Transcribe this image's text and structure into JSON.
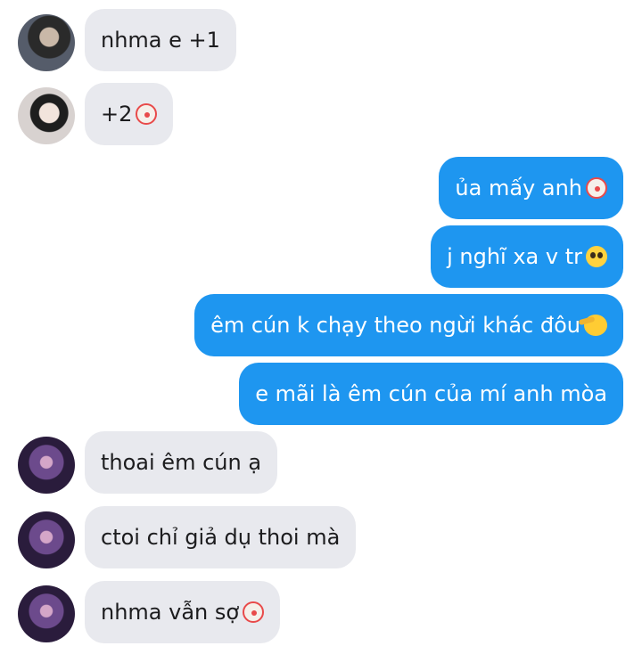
{
  "messages": [
    {
      "text": "nhma e +1",
      "emoji": ""
    },
    {
      "text": "+2",
      "emoji": "clown"
    },
    {
      "text": "ủa mấy anh",
      "emoji": "clown"
    },
    {
      "text": "j nghĩ xa v tr",
      "emoji": "pleading"
    },
    {
      "text": "êm cún k chạy theo ngừi khác đôu",
      "emoji": "saluting-face"
    },
    {
      "text": "e mãi là êm cún của mí anh mòa",
      "emoji": ""
    },
    {
      "text": "thoai êm cún ạ",
      "emoji": ""
    },
    {
      "text": "ctoi chỉ giả dụ thoi mà",
      "emoji": ""
    },
    {
      "text": "nhma vẫn sợ",
      "emoji": "clown"
    }
  ],
  "colors": {
    "incoming_bubble": "#e8e9ee",
    "outgoing_bubble": "#1e96f0",
    "incoming_text": "#1c1c1e",
    "outgoing_text": "#ffffff"
  }
}
